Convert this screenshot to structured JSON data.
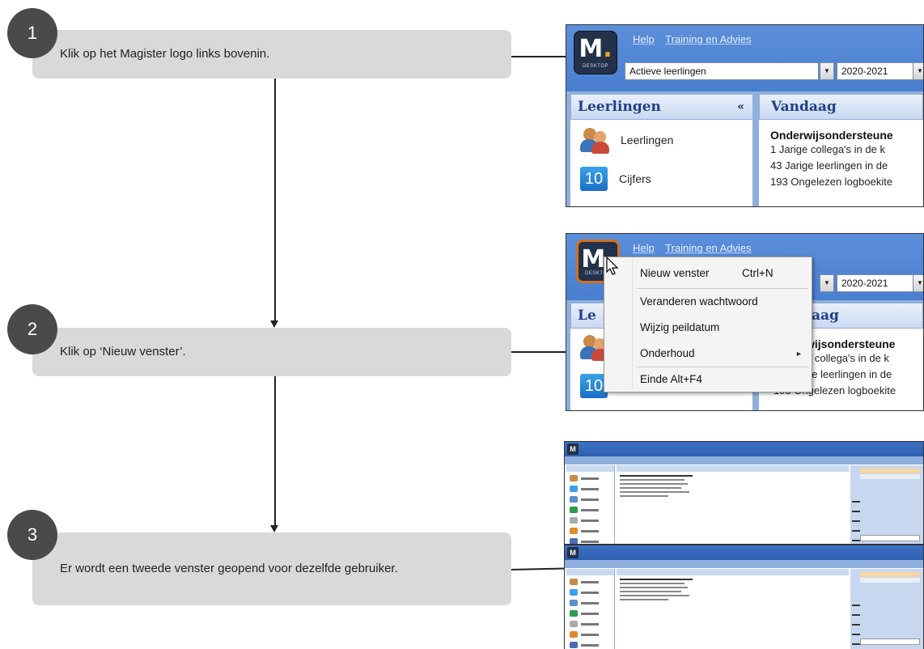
{
  "steps": [
    {
      "number": "1",
      "text": "Klik op het Magister logo links bovenin."
    },
    {
      "number": "2",
      "text": "Klik op ‘Nieuw venster’."
    },
    {
      "number": "3",
      "text": "Er wordt een tweede venster geopend voor dezelfde gebruiker."
    }
  ],
  "app": {
    "logo_letter": "M",
    "logo_sub": "DESKTOP",
    "menu": [
      "Help",
      "Training en Advies"
    ],
    "combo_value": "Actieve leerlingen",
    "year_value": "2020-2021",
    "nav_header": "Leerlingen",
    "nav_collapse": "«",
    "nav_items": [
      "Leerlingen",
      "Cijfers"
    ],
    "today_header": "Vandaag",
    "today_header_partial": "aag",
    "today_title": "Onderwijsondersteune",
    "today_title_partial": "wijsondersteune",
    "today_lines": [
      "1 Jarige collega's in de k",
      "43 Jarige leerlingen in de",
      "193 Ongelezen logboekite"
    ],
    "today_lines_partial": [
      "e collega's in de k",
      "ge leerlingen in de"
    ],
    "nav_header_partial": "Le",
    "nav_icon_ten": "10"
  },
  "context_menu": {
    "items": [
      {
        "label": "Nieuw venster",
        "shortcut": "Ctrl+N"
      },
      {
        "label": "Veranderen wachtwoord",
        "shortcut": ""
      },
      {
        "label": "Wijzig peildatum",
        "shortcut": ""
      },
      {
        "label": "Onderhoud",
        "shortcut": ""
      },
      {
        "label": "Einde Alt+F4",
        "shortcut": ""
      }
    ],
    "submenu_arrow": "►"
  },
  "icons": {
    "dropdown_arrow": "▼",
    "cursor": "pointer-cursor-icon"
  }
}
